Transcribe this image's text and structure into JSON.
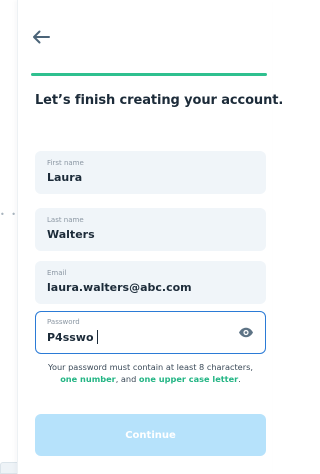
{
  "header": {
    "back_icon": "arrow-left-icon",
    "progress_percent": 100,
    "progress_color": "#2fc08f"
  },
  "title": "Let’s finish creating your account.",
  "form": {
    "first_name": {
      "label": "First name",
      "value": "Laura"
    },
    "last_name": {
      "label": "Last name",
      "value": "Walters"
    },
    "email": {
      "label": "Email",
      "value": "laura.walters@abc.com"
    },
    "password": {
      "label": "Password",
      "value": "P4sswo",
      "toggle_icon": "eye-icon",
      "focused": true
    }
  },
  "hint": {
    "part1": "Your password must contain at least 8 characters,",
    "highlight1": "one number",
    "part2": ", and",
    "highlight2": "one upper case letter",
    "part3": ".",
    "accent_color": "#23b584"
  },
  "continue_button": {
    "label": "Continue",
    "enabled": false,
    "color": "#b6e2fb"
  }
}
